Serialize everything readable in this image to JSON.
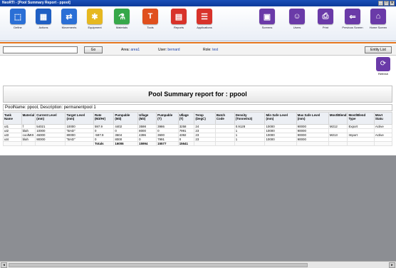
{
  "window": {
    "title": "NeoRTI - [Pool Summary Report - ppool]",
    "controls": [
      "_",
      "□",
      "x"
    ]
  },
  "toolbar": {
    "items": [
      {
        "label": "Define",
        "icon": "define-icon",
        "color": "#2a6fd6",
        "glyph": "⬚"
      },
      {
        "label": "Actions",
        "icon": "actions-icon",
        "color": "#1f5fc4",
        "glyph": "▦"
      },
      {
        "label": "Movements",
        "icon": "movements-icon",
        "color": "#2a6fd6",
        "glyph": "⇄"
      },
      {
        "label": "Equipment",
        "icon": "equipment-icon",
        "color": "#e6b820",
        "glyph": "✱"
      },
      {
        "label": "Materials",
        "icon": "materials-icon",
        "color": "#36a84a",
        "glyph": "⚗"
      },
      {
        "label": "Tools",
        "icon": "tools-icon",
        "color": "#e0501e",
        "glyph": "T"
      },
      {
        "label": "Reports",
        "icon": "reports-icon",
        "color": "#d8322a",
        "glyph": "▤"
      },
      {
        "label": "Applications",
        "icon": "applications-icon",
        "color": "#d8322a",
        "glyph": "☰"
      },
      {
        "label": "Screens",
        "icon": "screens-icon",
        "color": "#6a3aa8",
        "glyph": "▣"
      },
      {
        "label": "Users",
        "icon": "users-icon",
        "color": "#6a3aa8",
        "glyph": "☺"
      },
      {
        "label": "Print",
        "icon": "print-icon",
        "color": "#6a3aa8",
        "glyph": "⎙"
      },
      {
        "label": "Previous Screen",
        "icon": "previous-screen-icon",
        "color": "#6a3aa8",
        "glyph": "⇐"
      },
      {
        "label": "Home Screen",
        "icon": "home-screen-icon",
        "color": "#6a3aa8",
        "glyph": "⌂"
      }
    ]
  },
  "infobar": {
    "search_value": "",
    "go_label": "Go",
    "area_label": "Area:",
    "area_value": "area1",
    "user_label": "User:",
    "user_value": "bernard",
    "role_label": "Role:",
    "role_value": "test",
    "entity_list_label": "Entity List"
  },
  "refresh": {
    "label": "Refresh",
    "glyph": "⟳"
  },
  "report": {
    "title": "Pool Summary report for : ppool",
    "pool_line": "PoolName: ppool, Description: permanentpool 1"
  },
  "table": {
    "headers": [
      "Tank Name",
      "Material",
      "Current Level (mm)",
      "Target Level (mm)",
      "Rate (M3/Hr)",
      "Pumpable (M3)",
      "Ullage (M3)",
      "Pumpable (T)",
      "Ullage (T)",
      "Temp (DegC)",
      "Batch Code",
      "Density (Tonne/m3)",
      "Min Safe Level (mm)",
      "Max Safe Level (mm)",
      "Movt/Blend",
      "Movt/Blend Type",
      "Movt Statu"
    ],
    "rows": [
      [
        "ut1",
        "f",
        "54021",
        "10000",
        "597.9",
        "4402",
        "3598",
        "3986",
        "3258",
        "24",
        "",
        "0.9128",
        "10000",
        "90000",
        "M212",
        "Export",
        "Active"
      ],
      [
        "ut2",
        "blah",
        "10000",
        "\"BAD\"",
        "0",
        "0",
        "8000",
        "0",
        "7991",
        "23",
        "",
        "1",
        "10000",
        "90000",
        "",
        "",
        ""
      ],
      [
        "ut3",
        "coolMIX",
        "46000",
        "80000",
        "-597.9",
        "3604",
        "4396",
        "3600",
        "4392",
        "23",
        "",
        "1",
        "10000",
        "90000",
        "M213",
        "Import",
        "Active"
      ],
      [
        "ut4",
        "blah",
        "90000",
        "\"BAD\"",
        "0",
        "8000",
        "0",
        "7991",
        "0",
        "23",
        "",
        "1",
        "10000",
        "90000",
        "",
        "",
        ""
      ]
    ],
    "totals": [
      "",
      "",
      "",
      "",
      "Totals",
      "16006",
      "15994",
      "15577",
      "15641",
      "",
      "",
      "",
      "",
      "",
      "",
      "",
      ""
    ]
  },
  "scrollbar": {
    "left": "◂",
    "right": "▸"
  }
}
